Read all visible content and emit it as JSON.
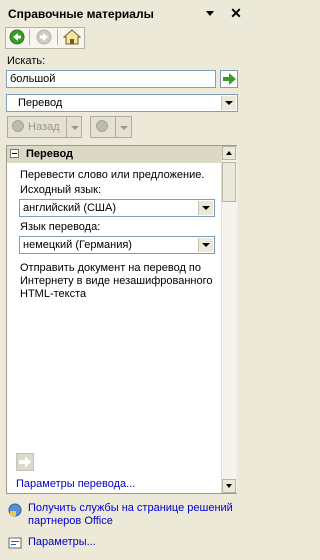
{
  "header": {
    "title": "Справочные материалы"
  },
  "search": {
    "label": "Искать:",
    "value": "большой"
  },
  "service_select": {
    "value": "Перевод"
  },
  "nav": {
    "back_label": "Назад"
  },
  "section": {
    "title": "Перевод",
    "intro": "Перевести слово или предложение.",
    "source_label": "Исходный язык:",
    "source_value": "английский (США)",
    "target_label": "Язык перевода:",
    "target_value": "немецкий (Германия)",
    "send_text": "Отправить документ на перевод по Интернету в виде незашифрованного HTML-текста",
    "options_link": "Параметры перевода..."
  },
  "footer": {
    "services_link": "Получить службы на странице решений партнеров Office",
    "settings_link": "Параметры..."
  },
  "colors": {
    "accent_green": "#3a9a2a",
    "link_blue": "#0000cc",
    "panel_header": "#dcd8c6"
  }
}
